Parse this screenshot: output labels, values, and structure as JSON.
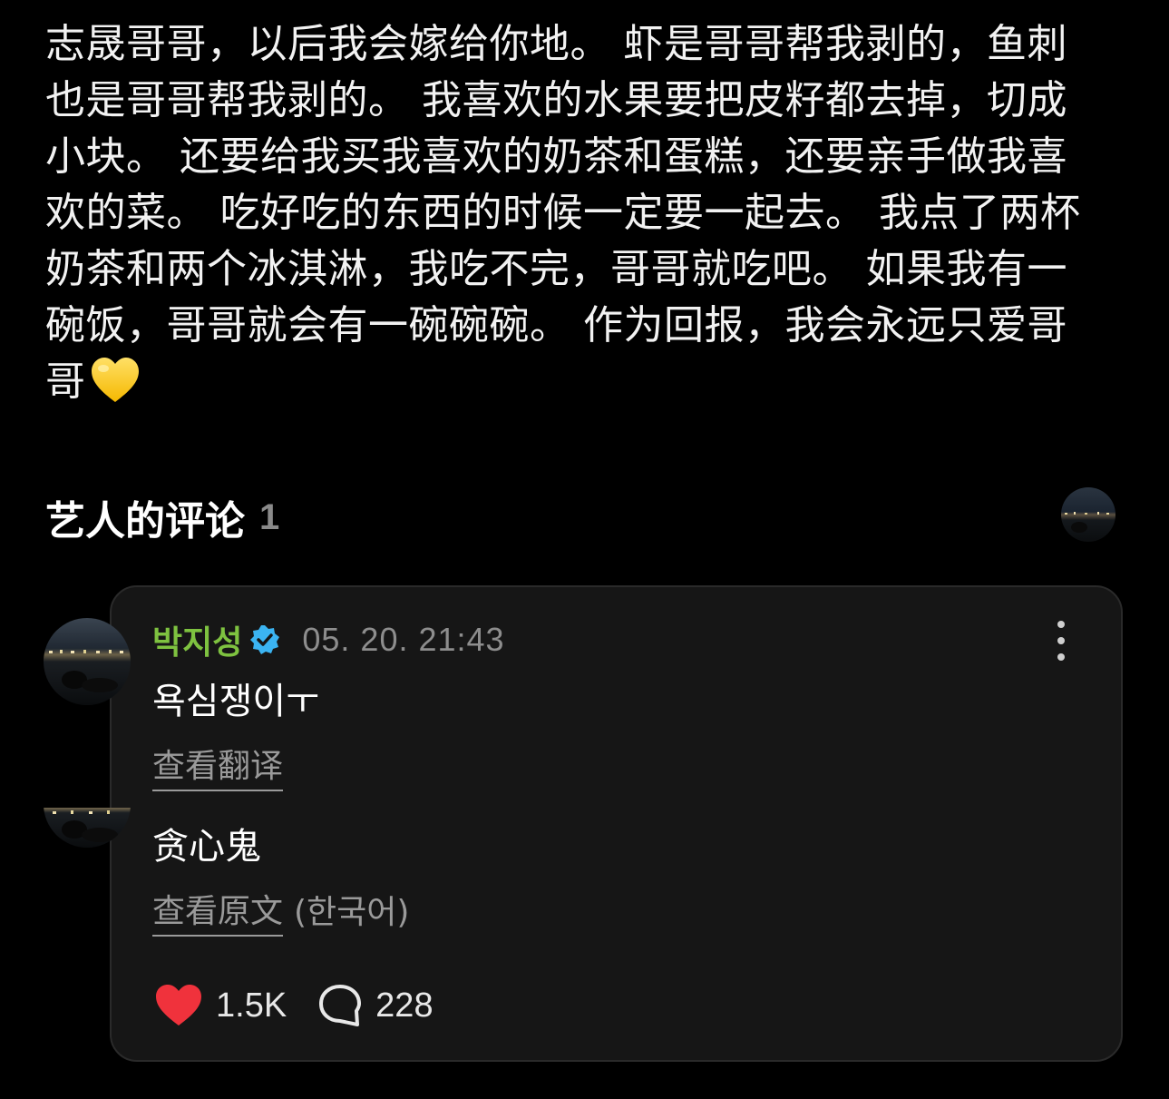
{
  "post": {
    "lines": [
      "志晟哥哥，以后我会嫁给你地。 虾是哥哥帮我剥的，鱼刺",
      "也是哥哥帮我剥的。 我喜欢的水果要把皮籽都去掉，切成",
      "小块。 还要给我买我喜欢的奶茶和蛋糕，还要亲手做我喜",
      "欢的菜。 吃好吃的东西的时候一定要一起去。 我点了两杯",
      "奶茶和两个冰淇淋，我吃不完，哥哥就吃吧。 如果我有一",
      "碗饭，哥哥就会有一碗碗碗。 作为回报，我会永远只爱哥",
      "哥"
    ],
    "emoji": "yellow-heart"
  },
  "comments_section": {
    "title": "艺人的评论",
    "count": "1"
  },
  "comment": {
    "author": "박지성",
    "time": "05. 20. 21:43",
    "text": "욕심쟁이ㅜ",
    "translate_label": "查看翻译",
    "translated_text": "贪心鬼",
    "view_original_label": "查看原文",
    "original_language": "(한국어)",
    "likes": "1.5K",
    "replies": "228"
  },
  "colors": {
    "author": "#7ec240",
    "verified": "#3bb4f2",
    "like": "#f0323c",
    "background": "#000000",
    "card": "#161616"
  }
}
